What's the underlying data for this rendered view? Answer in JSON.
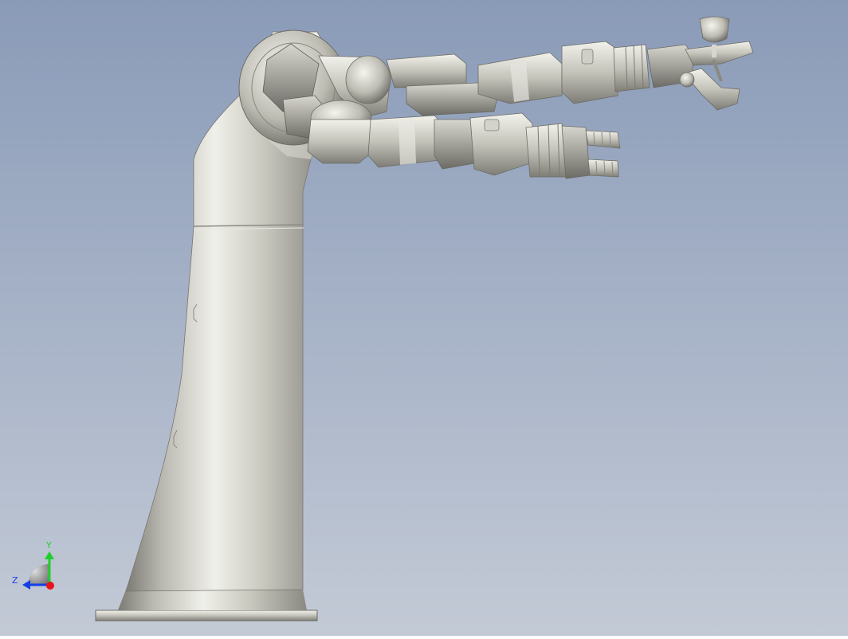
{
  "viewport": {
    "background_top": "#8a9bb8",
    "background_bottom": "#c3cad6",
    "model_color": "#c9c8bf",
    "model_shadow": "#6f6f69",
    "model_highlight": "#f2f2ec"
  },
  "triad": {
    "y_label": "Y",
    "z_label": "Z",
    "y_color": "#1fcf2a",
    "z_color": "#1540e6",
    "origin_color": "#e8141b"
  }
}
